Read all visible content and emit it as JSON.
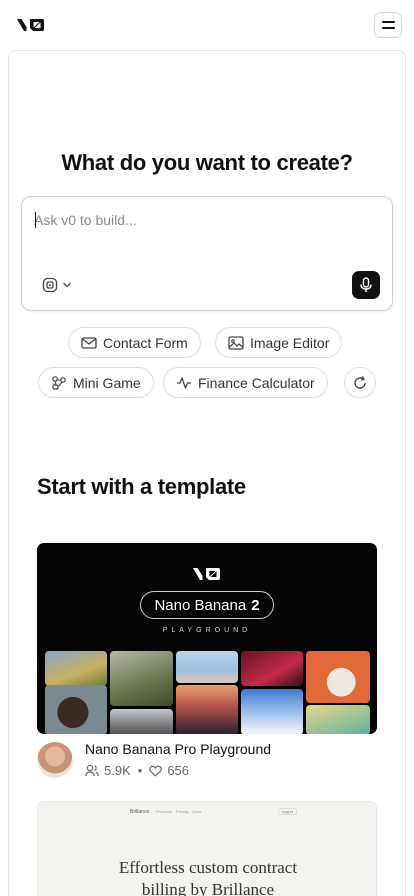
{
  "header": {
    "logo_icon": "v0-logo",
    "menu_icon": "hamburger-menu-icon"
  },
  "hero": {
    "title": "What do you want to create?"
  },
  "prompt": {
    "placeholder": "Ask v0 to build...",
    "value": "",
    "attach_icon": "attachment-icon",
    "dropdown_icon": "chevron-down-icon",
    "mic_icon": "microphone-icon"
  },
  "suggestions": [
    {
      "label": "Contact Form",
      "icon": "mail-icon"
    },
    {
      "label": "Image Editor",
      "icon": "image-icon"
    },
    {
      "label": "Mini Game",
      "icon": "game-icon"
    },
    {
      "label": "Finance Calculator",
      "icon": "activity-icon"
    }
  ],
  "refresh_icon": "refresh-icon",
  "templates": {
    "title": "Start with a template",
    "cards": [
      {
        "thumb_pill_text": "Nano Banana",
        "thumb_pill_badge": "2",
        "thumb_subtitle": "PLAYGROUND",
        "title": "Nano Banana Pro Playground",
        "users": "5.9K",
        "separator": "•",
        "likes": "656"
      },
      {
        "nav_brand": "Brillance",
        "nav_links": "Products Pricing Docs",
        "nav_login": "Log in",
        "headline_line1": "Effortless custom contract",
        "headline_line2": "billing by Brillance"
      }
    ]
  },
  "colors": {
    "text": "#111111",
    "muted": "#666666",
    "border": "#dedede",
    "dark": "#111111"
  }
}
